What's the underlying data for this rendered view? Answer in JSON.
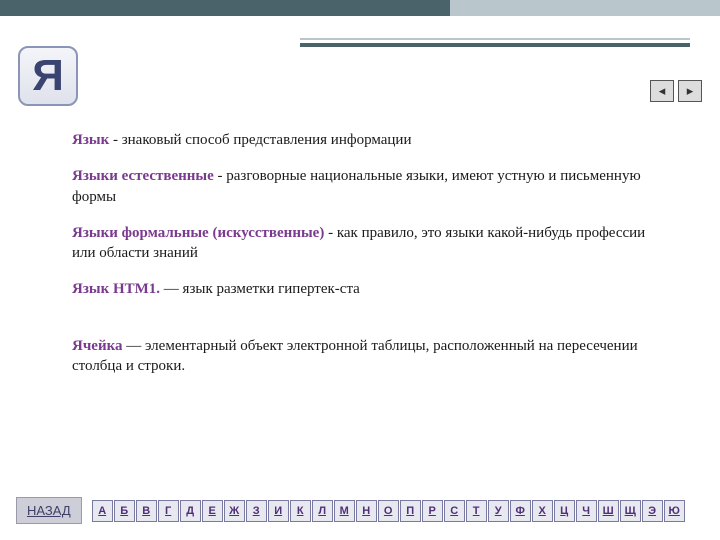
{
  "letter": "Я",
  "nav": {
    "prev_label": "◂",
    "next_label": "▸"
  },
  "entries": [
    {
      "term": "Язык",
      "paren": "",
      "sep": " - ",
      "def": "знаковый способ представления информации"
    },
    {
      "term": "Языки естественные",
      "paren": "",
      "sep": " - ",
      "def": "разговорные национальные языки, имеют устную и письменную формы"
    },
    {
      "term": "Языки формальные",
      "paren": " (искусственные)",
      "sep": " - ",
      "def": "как правило, это языки какой-нибудь профессии или области знаний"
    },
    {
      "term": "Язык HTM1.",
      "paren": "",
      "sep": " — ",
      "def": "язык разметки гипертек-ста"
    },
    {
      "term": "Ячейка",
      "paren": "",
      "sep": " — ",
      "def": "элементарный объект электронной таблицы, расположенный на пересечении столбца и строки."
    }
  ],
  "footer": {
    "back_label": "НАЗАД",
    "alphabet": [
      "А",
      "Б",
      "В",
      "Г",
      "Д",
      "Е",
      "Ж",
      "З",
      "И",
      "К",
      "Л",
      "М",
      "Н",
      "О",
      "П",
      "Р",
      "С",
      "Т",
      "У",
      "Ф",
      "Х",
      "Ц",
      "Ч",
      "Ш",
      "Щ",
      "Э",
      "Ю"
    ]
  }
}
